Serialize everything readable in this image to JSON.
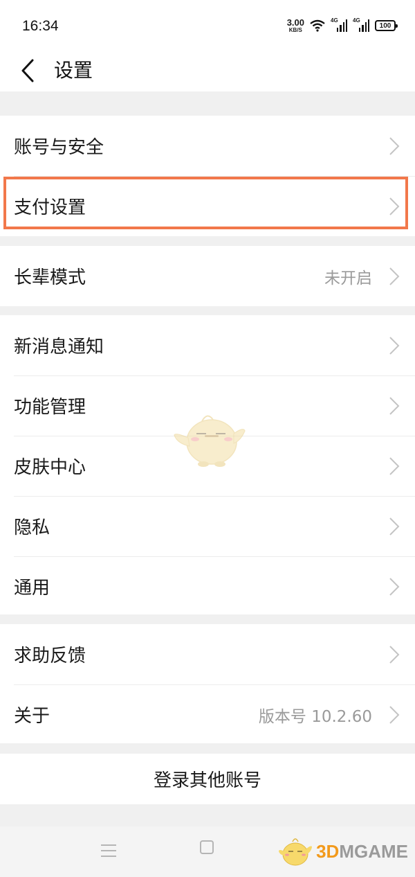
{
  "status_bar": {
    "time": "16:34",
    "net_speed": "3.00",
    "net_speed_unit": "KB/S",
    "signal_1": "4G",
    "signal_2": "4G",
    "battery": "100"
  },
  "header": {
    "title": "设置"
  },
  "groups": [
    {
      "items": [
        {
          "label": "账号与安全"
        },
        {
          "label": "支付设置"
        }
      ]
    },
    {
      "items": [
        {
          "label": "长辈模式",
          "value": "未开启"
        }
      ]
    },
    {
      "items": [
        {
          "label": "新消息通知"
        },
        {
          "label": "功能管理"
        },
        {
          "label": "皮肤中心"
        },
        {
          "label": "隐私"
        },
        {
          "label": "通用"
        }
      ]
    },
    {
      "items": [
        {
          "label": "求助反馈"
        },
        {
          "label": "关于",
          "value": "版本号 10.2.60"
        }
      ]
    }
  ],
  "login_other": "登录其他账号",
  "watermark": {
    "prefix": "3D",
    "suffix": "MGAME"
  },
  "colors": {
    "highlight": "#f2784b",
    "background": "#f0f0f0",
    "secondary_text": "#9a9a9a"
  }
}
